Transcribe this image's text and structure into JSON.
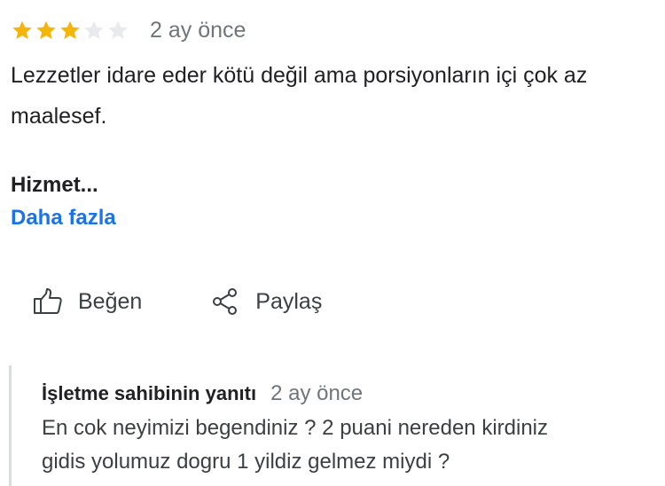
{
  "review": {
    "rating": 3,
    "max_rating": 5,
    "star_color": "#f5b50a",
    "empty_star_color": "#e8eaed",
    "time": "2 ay önce",
    "text": "Lezzetler idare eder kötü değil ama porsiyonların içi çok az maalesef.",
    "service_label": "Hizmet...",
    "more_link": "Daha fazla",
    "link_color": "#1a73e8"
  },
  "actions": {
    "like": {
      "label": "Beğen",
      "icon": "thumbs-up-icon"
    },
    "share": {
      "label": "Paylaş",
      "icon": "share-icon"
    }
  },
  "owner_reply": {
    "author": "İşletme sahibinin yanıtı",
    "time": "2 ay önce",
    "text_line1": "En cok neyimizi begendiniz ?  2 puani nereden kirdiniz",
    "text_line2": "gidis yolumuz dogru 1 yildiz gelmez miydi ?"
  }
}
